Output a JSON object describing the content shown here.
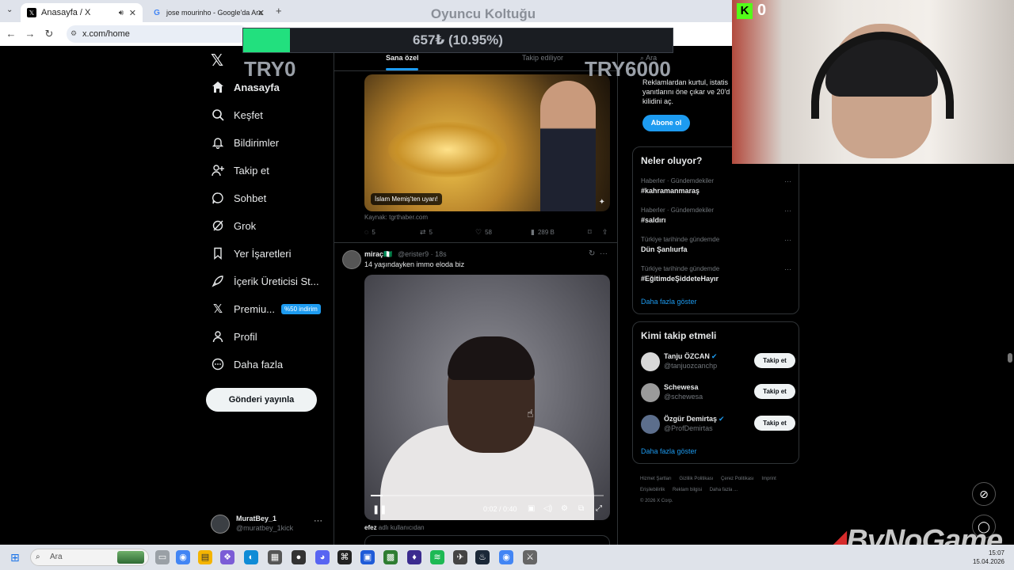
{
  "browser": {
    "tabs": [
      {
        "title": "Anasayfa / X",
        "icon": "x-icon"
      },
      {
        "title": "jose mourinho - Google'da Ara",
        "icon": "google-icon"
      }
    ],
    "url": "x.com/home"
  },
  "overlay": {
    "title": "Oyuncu Koltuğu",
    "progress_text": "657₺ (10.95%)",
    "progress_fraction": 0.1095,
    "progress_color": "#22e07e",
    "left_label": "TRY0",
    "right_label": "TRY6000",
    "webcam_counter": "0",
    "brand_logo": "ByNoGame"
  },
  "nav": {
    "items": [
      {
        "label": "Anasayfa",
        "icon": "home-icon"
      },
      {
        "label": "Keşfet",
        "icon": "search-icon"
      },
      {
        "label": "Bildirimler",
        "icon": "bell-icon"
      },
      {
        "label": "Takip et",
        "icon": "person-add-icon"
      },
      {
        "label": "Sohbet",
        "icon": "chat-icon"
      },
      {
        "label": "Grok",
        "icon": "grok-icon"
      },
      {
        "label": "Yer İşaretleri",
        "icon": "bookmark-icon"
      },
      {
        "label": "İçerik Üreticisi St...",
        "icon": "rocket-icon"
      },
      {
        "label": "Premiu...",
        "icon": "x-premium-icon",
        "badge": "%50 indirim"
      },
      {
        "label": "Profil",
        "icon": "person-icon"
      },
      {
        "label": "Daha fazla",
        "icon": "more-circle-icon"
      }
    ],
    "post_button": "Gönderi yayınla",
    "account": {
      "name": "MuratBey_1",
      "handle": "@muratbey_1kick"
    }
  },
  "main": {
    "tabs": {
      "for_you": "Sana özel",
      "following": "Takip ediliyor"
    },
    "tweet1": {
      "image_caption": "İslam Memiş'ten uyarı!",
      "source": "Kaynak: tgrthaber.com",
      "replies": "5",
      "retweets": "5",
      "likes": "58",
      "views": "289 B"
    },
    "tweet2": {
      "name": "miraç🇳🇬",
      "handle_time": "@erister9 · 18s",
      "text": "14 yaşındayken immo eloda biz",
      "video_time": "0:02 / 0:40",
      "video_progress": 0.05,
      "quote_user": "efez",
      "quote_label": "adlı kullanıcıdan"
    }
  },
  "right": {
    "search_placeholder": "Ara",
    "premium_text": "Reklamlardan kurtul, istatis yanıtlarını öne çıkar ve 20'd kilidini aç.",
    "subscribe_button": "Abone ol",
    "trends_title": "Neler oluyor?",
    "trends": [
      {
        "category": "Haberler · Gündemdekiler",
        "name": "#kahramanmaraş"
      },
      {
        "category": "Haberler · Gündemdekiler",
        "name": "#saldırı"
      },
      {
        "category": "Türkiye tarihinde gündemde",
        "name": "Dün Şanlıurfa"
      },
      {
        "category": "Türkiye tarihinde gündemde",
        "name": "#EğitimdeŞiddeteHayır"
      }
    ],
    "trends_more": "Daha fazla göster",
    "follow_title": "Kimi takip etmeli",
    "follow": [
      {
        "name": "Tanju ÖZCAN",
        "handle": "@tanjuozcanchp",
        "verified": true
      },
      {
        "name": "Schewesa",
        "handle": "@schewesa",
        "verified": false
      },
      {
        "name": "Özgür Demirtaş",
        "handle": "@ProfDemirtas",
        "verified": true
      }
    ],
    "follow_button": "Takip et",
    "follow_more": "Daha fazla göster",
    "footer": [
      "Hizmet Şartları",
      "Gizlilik Politikası",
      "Çerez Politikası",
      "Imprint",
      "Erişilebilirlik",
      "Reklam bilgisi",
      "Daha fazla ...",
      "© 2026 X Corp."
    ]
  },
  "taskbar": {
    "search_placeholder": "Ara",
    "time": "15:07",
    "date": "15.04.2026"
  }
}
